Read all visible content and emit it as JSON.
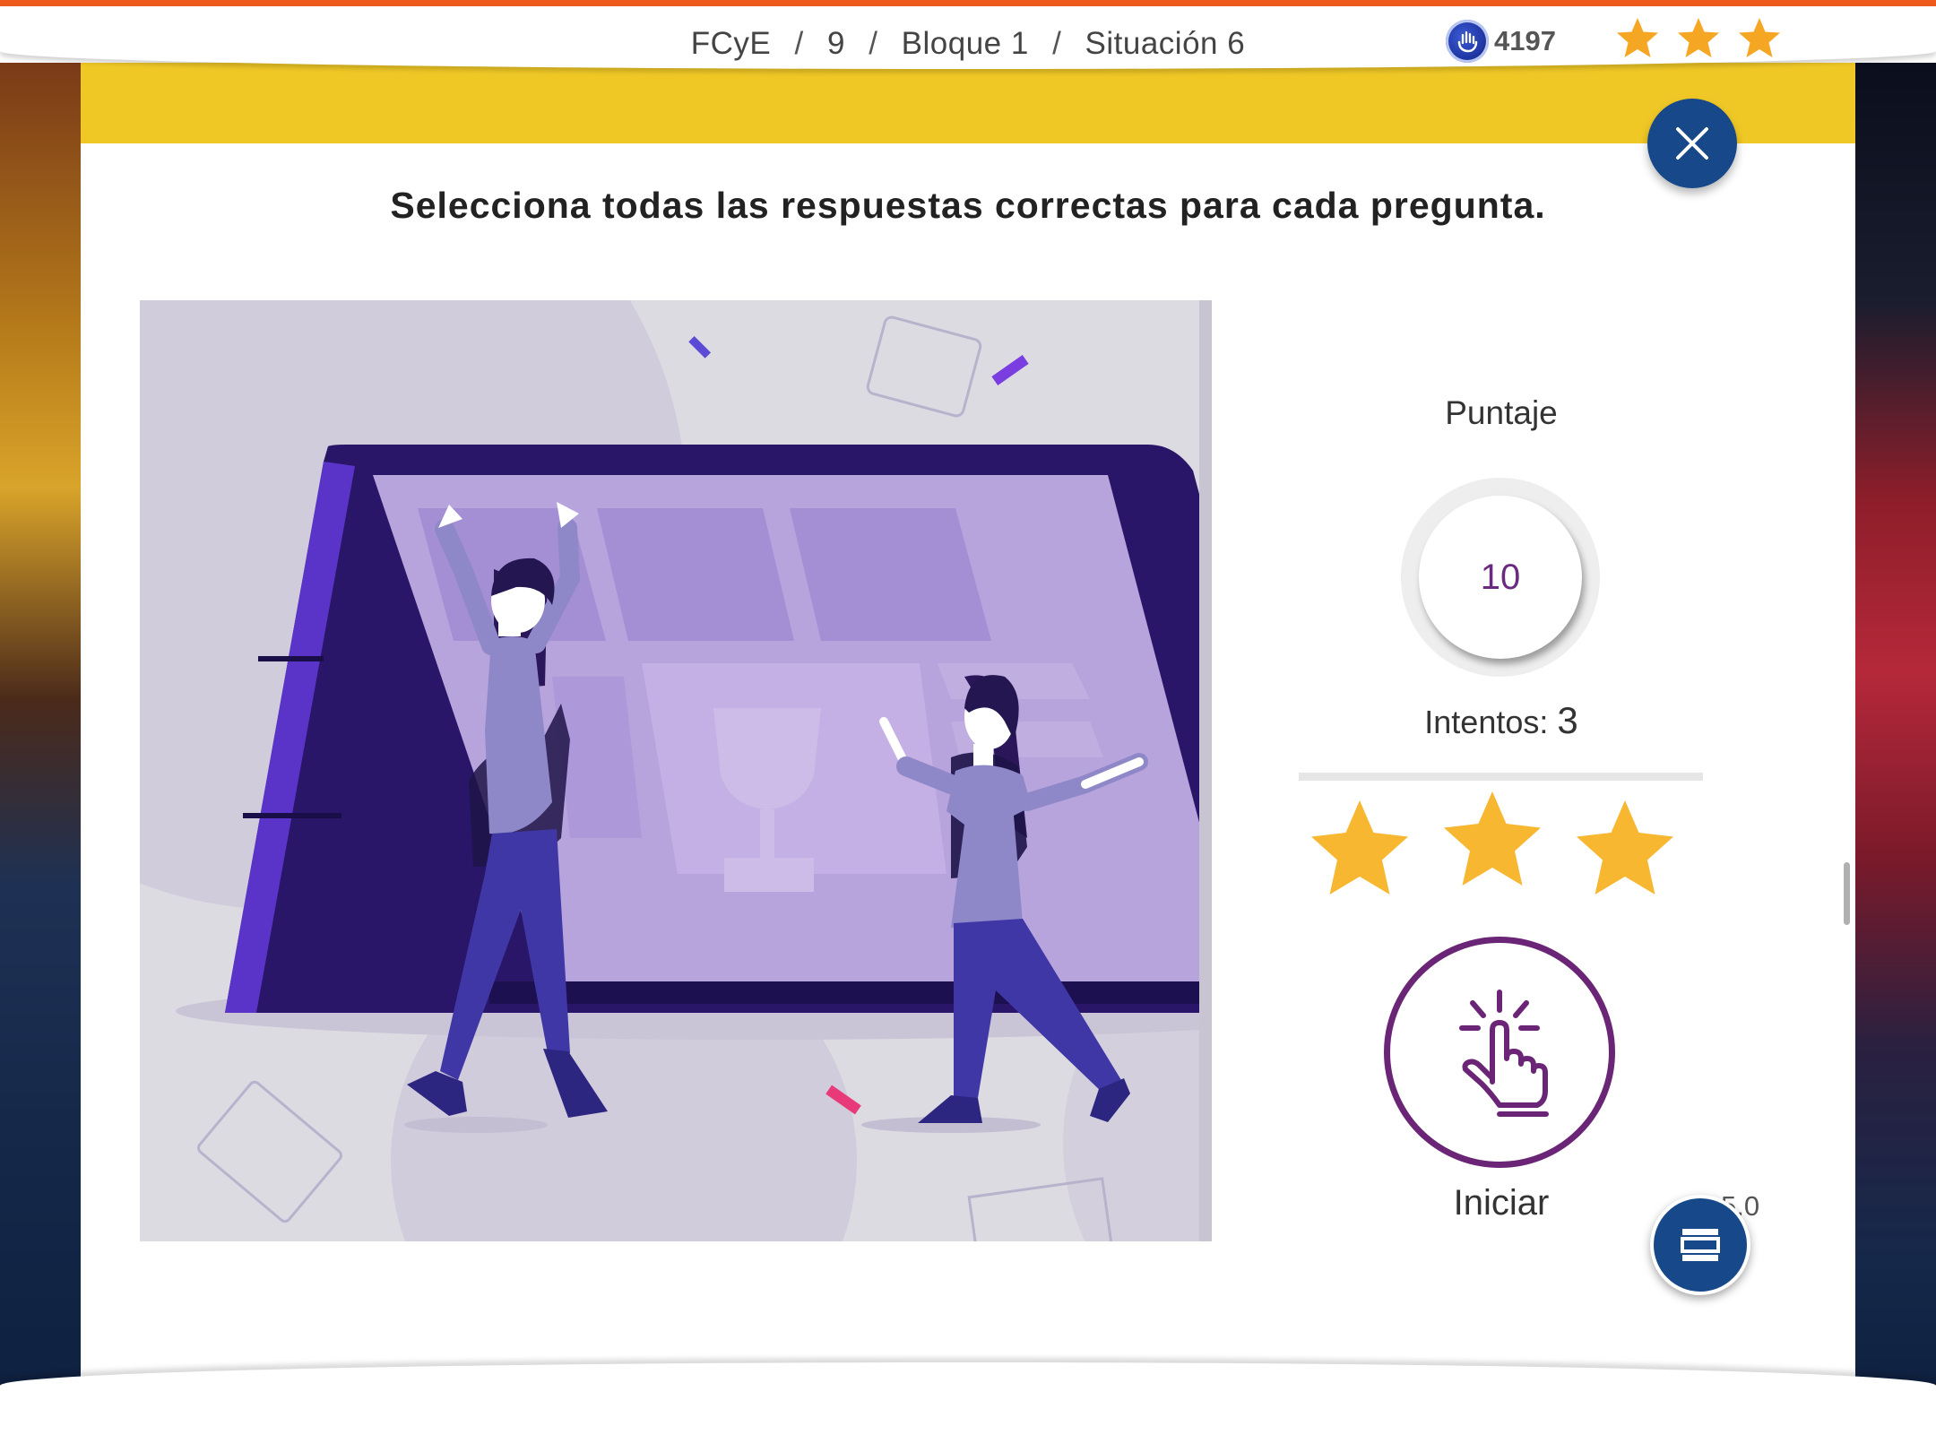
{
  "header": {
    "breadcrumb": [
      "FCyE",
      "9",
      "Bloque 1",
      "Situación 6"
    ],
    "separator": "/",
    "coins": "4197",
    "coin_icon": "hand-coin-icon",
    "stars_earned": 3,
    "stars_total": 3,
    "star_color": "#f5a623"
  },
  "activity": {
    "instruction": "Selecciona todas las respuestas correctas para cada pregunta.",
    "illustration": "celebration-illustration",
    "score_label": "Puntaje",
    "score_value": "10",
    "attempts_label": "Intentos:",
    "attempts_value": "3",
    "stars_earned": 3,
    "stars_total": 3,
    "start_icon": "tap-hand-icon",
    "start_label": "Iniciar",
    "version": "5.0"
  },
  "colors": {
    "accent_top": "#ee5a1c",
    "banner_yellow": "#f0c826",
    "button_blue": "#17498a",
    "start_purple": "#6b2577",
    "big_star": "#f7b731"
  }
}
